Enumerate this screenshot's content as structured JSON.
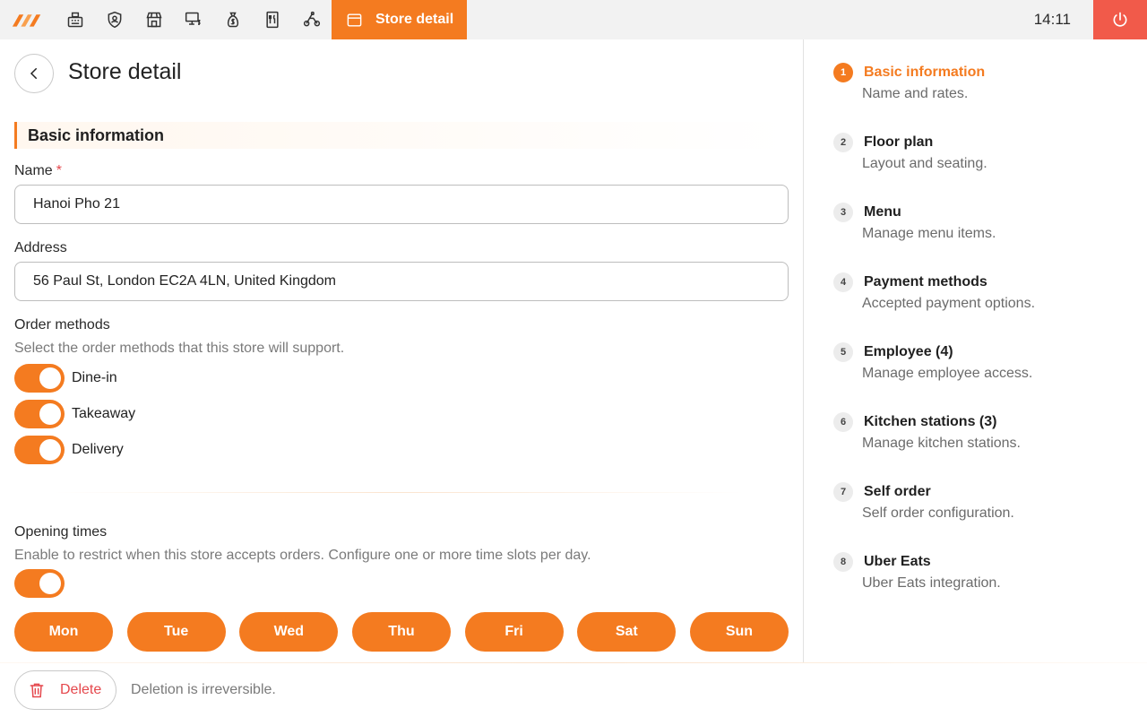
{
  "topbar": {
    "active_tab_label": "Store detail",
    "clock": "14:11",
    "nav_icons": [
      "cash-register-icon",
      "shield-user-icon",
      "store-icon",
      "pos-terminal-icon",
      "money-bag-icon",
      "menu-card-icon",
      "delivery-bike-icon"
    ]
  },
  "page": {
    "title": "Store detail"
  },
  "basic": {
    "section_title": "Basic information",
    "name_label": "Name",
    "name_required": "*",
    "name_value": "Hanoi Pho 21",
    "address_label": "Address",
    "address_value": "56 Paul St, London EC2A 4LN, United Kingdom"
  },
  "order_methods": {
    "label": "Order methods",
    "hint": "Select the order methods that this store will support.",
    "items": [
      {
        "label": "Dine-in",
        "enabled": true
      },
      {
        "label": "Takeaway",
        "enabled": true
      },
      {
        "label": "Delivery",
        "enabled": true
      }
    ]
  },
  "opening_times": {
    "label": "Opening times",
    "hint": "Enable to restrict when this store accepts orders. Configure one or more time slots per day.",
    "enabled": true,
    "days": [
      "Mon",
      "Tue",
      "Wed",
      "Thu",
      "Fri",
      "Sat",
      "Sun"
    ]
  },
  "footer": {
    "delete_label": "Delete",
    "delete_note": "Deletion is irreversible."
  },
  "steps": [
    {
      "num": "1",
      "title": "Basic information",
      "sub": "Name and rates.",
      "active": true
    },
    {
      "num": "2",
      "title": "Floor plan",
      "sub": "Layout and seating.",
      "active": false
    },
    {
      "num": "3",
      "title": "Menu",
      "sub": "Manage menu items.",
      "active": false
    },
    {
      "num": "4",
      "title": "Payment methods",
      "sub": "Accepted payment options.",
      "active": false
    },
    {
      "num": "5",
      "title": "Employee (4)",
      "sub": "Manage employee access.",
      "active": false
    },
    {
      "num": "6",
      "title": "Kitchen stations (3)",
      "sub": "Manage kitchen stations.",
      "active": false
    },
    {
      "num": "7",
      "title": "Self order",
      "sub": "Self order configuration.",
      "active": false
    },
    {
      "num": "8",
      "title": "Uber Eats",
      "sub": "Uber Eats integration.",
      "active": false
    }
  ],
  "colors": {
    "accent": "#f47b20",
    "danger": "#f15a4a",
    "muted": "#7a7a7a"
  }
}
